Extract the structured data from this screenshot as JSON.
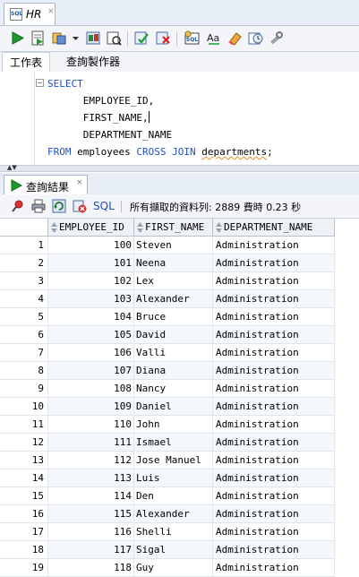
{
  "editor_tab": {
    "label": "HR"
  },
  "worksheet_tabs": [
    {
      "label": "工作表"
    },
    {
      "label": "查詢製作器"
    }
  ],
  "sql": {
    "select_kw": "SELECT",
    "col1": "EMPLOYEE_ID,",
    "col2": "FIRST_NAME,",
    "col3": "DEPARTMENT_NAME",
    "from_kw": "FROM",
    "table1": "employees",
    "join_kw": "CROSS JOIN",
    "table2": "departments",
    "terminator": ";"
  },
  "results_tab": {
    "label": "查詢結果"
  },
  "results_toolbar": {
    "sql_label": "SQL",
    "status": "所有擷取的資料列: 2889 費時 0.23 秒"
  },
  "grid": {
    "columns": [
      "EMPLOYEE_ID",
      "FIRST_NAME",
      "DEPARTMENT_NAME"
    ],
    "rows": [
      {
        "n": "1",
        "id": "100",
        "first": "Steven",
        "dept": "Administration"
      },
      {
        "n": "2",
        "id": "101",
        "first": "Neena",
        "dept": "Administration"
      },
      {
        "n": "3",
        "id": "102",
        "first": "Lex",
        "dept": "Administration"
      },
      {
        "n": "4",
        "id": "103",
        "first": "Alexander",
        "dept": "Administration"
      },
      {
        "n": "5",
        "id": "104",
        "first": "Bruce",
        "dept": "Administration"
      },
      {
        "n": "6",
        "id": "105",
        "first": "David",
        "dept": "Administration"
      },
      {
        "n": "7",
        "id": "106",
        "first": "Valli",
        "dept": "Administration"
      },
      {
        "n": "8",
        "id": "107",
        "first": "Diana",
        "dept": "Administration"
      },
      {
        "n": "9",
        "id": "108",
        "first": "Nancy",
        "dept": "Administration"
      },
      {
        "n": "10",
        "id": "109",
        "first": "Daniel",
        "dept": "Administration"
      },
      {
        "n": "11",
        "id": "110",
        "first": "John",
        "dept": "Administration"
      },
      {
        "n": "12",
        "id": "111",
        "first": "Ismael",
        "dept": "Administration"
      },
      {
        "n": "13",
        "id": "112",
        "first": "Jose Manuel",
        "dept": "Administration"
      },
      {
        "n": "14",
        "id": "113",
        "first": "Luis",
        "dept": "Administration"
      },
      {
        "n": "15",
        "id": "114",
        "first": "Den",
        "dept": "Administration"
      },
      {
        "n": "16",
        "id": "115",
        "first": "Alexander",
        "dept": "Administration"
      },
      {
        "n": "17",
        "id": "116",
        "first": "Shelli",
        "dept": "Administration"
      },
      {
        "n": "18",
        "id": "117",
        "first": "Sigal",
        "dept": "Administration"
      },
      {
        "n": "19",
        "id": "118",
        "first": "Guy",
        "dept": "Administration"
      }
    ]
  },
  "toolbar_icons": [
    "run-statement-icon",
    "run-script-icon",
    "explain-plan-icon",
    "dropdown-arrow-icon",
    "autotrace-icon",
    "sql-tuning-icon",
    "commit-icon",
    "rollback-icon",
    "unshared-sql-icon",
    "change-case-icon",
    "clear-icon",
    "sql-history-icon",
    "tools-icon"
  ],
  "accent_colors": {
    "keyword": "#1f4fc8",
    "run_green": "#1e9a2e"
  }
}
